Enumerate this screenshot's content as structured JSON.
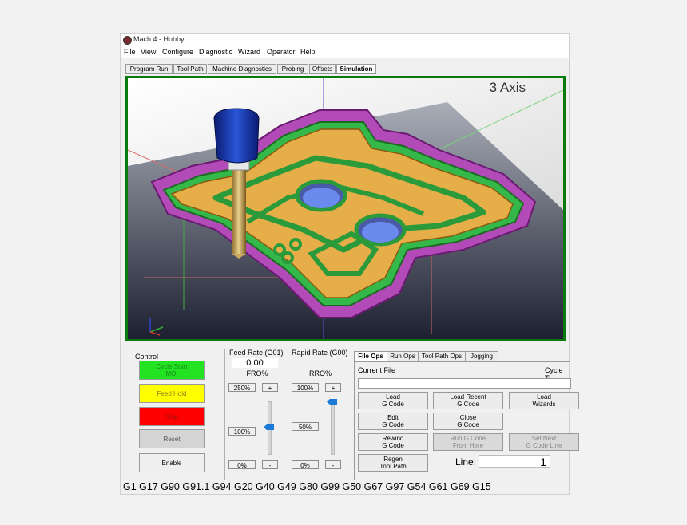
{
  "app": {
    "title": "Mach 4 - Hobby"
  },
  "menu": [
    "File",
    "View",
    "Configure",
    "Diagnostic",
    "Wizard",
    "Operator",
    "Help"
  ],
  "tabs": [
    "Program Run",
    "Tool Path",
    "Machine Diagnostics",
    "Probing",
    "Offsets",
    "Simulation"
  ],
  "active_tab": "Simulation",
  "simulation": {
    "axis_label": "3 Axis"
  },
  "control": {
    "label": "Control",
    "cycle_start": "Cycle Start",
    "cycle_start_sub": "MOI",
    "feed_hold": "Feed Hold",
    "stop": "Stop",
    "reset": "Reset",
    "enable": "Enable",
    "colors": {
      "cycle_start": "#22e222",
      "feed_hold": "#ffff00",
      "stop": "#ff0000"
    }
  },
  "feed_rate": {
    "label": "Feed Rate (G01)",
    "value": "0.00",
    "fro_label": "FRO%",
    "max": "250%",
    "plus": "+",
    "current": "100%",
    "min": "0%",
    "minus": "-",
    "level_percent": 100
  },
  "rapid_rate": {
    "label": "Rapid Rate (G00)",
    "rro_label": "RRO%",
    "max": "100%",
    "plus": "+",
    "current": "50%",
    "min": "0%",
    "minus": "-",
    "level_percent": 100
  },
  "bottom_tabs": [
    "File Ops",
    "Run Ops",
    "Tool Path Ops",
    "Jogging"
  ],
  "file_ops": {
    "current_file_label": "Current File",
    "cycle_time_label": "Cycle Ti",
    "buttons": {
      "load_gcode": [
        "Load",
        "G Code"
      ],
      "load_recent": [
        "Load Recent",
        "G Code"
      ],
      "load_wizards": [
        "Load",
        "Wizards"
      ],
      "edit_gcode": [
        "Edit",
        "G Code"
      ],
      "close_gcode": [
        "Close",
        "G Code"
      ],
      "rewind_gcode": [
        "Rewind",
        "G Code"
      ],
      "run_from_here": [
        "Run G Code",
        "From Here"
      ],
      "set_next_line": [
        "Set Next",
        "G Code Line"
      ],
      "regen_toolpath": [
        "Regen",
        "Tool Path"
      ]
    },
    "line_label": "Line:",
    "line_value": "1"
  },
  "gcode_status": "G1 G17 G90 G91.1 G94 G20 G40 G49 G80 G99 G50 G67 G97 G54 G61 G69 G15"
}
